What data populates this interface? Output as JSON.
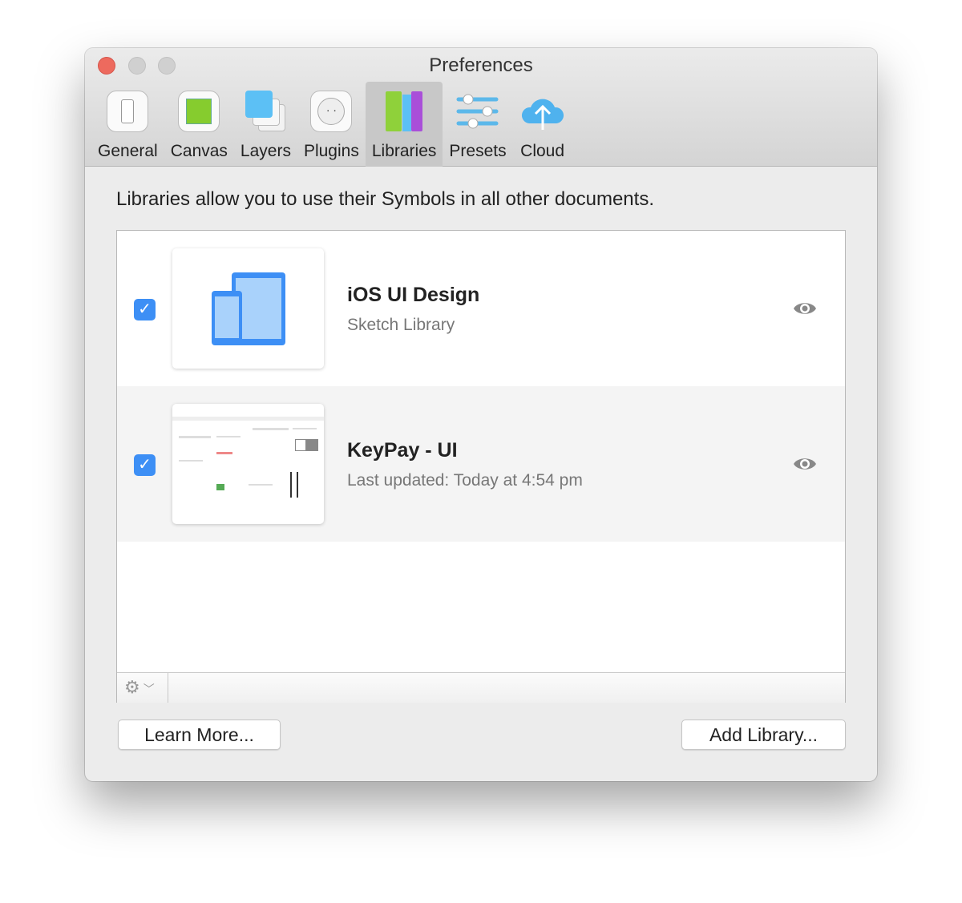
{
  "window": {
    "title": "Preferences"
  },
  "tabs": [
    {
      "label": "General",
      "icon": "general-switch-icon"
    },
    {
      "label": "Canvas",
      "icon": "canvas-icon"
    },
    {
      "label": "Layers",
      "icon": "layers-icon"
    },
    {
      "label": "Plugins",
      "icon": "plugins-icon"
    },
    {
      "label": "Libraries",
      "icon": "libraries-icon",
      "active": true
    },
    {
      "label": "Presets",
      "icon": "presets-icon"
    },
    {
      "label": "Cloud",
      "icon": "cloud-icon"
    }
  ],
  "description": "Libraries allow you to use their Symbols in all other documents.",
  "libraries": [
    {
      "name": "iOS UI Design",
      "subtitle": "Sketch Library",
      "enabled": true
    },
    {
      "name": "KeyPay - UI",
      "subtitle": "Last updated: Today at 4:54 pm",
      "enabled": true
    }
  ],
  "buttons": {
    "learn_more": "Learn More...",
    "add_library": "Add Library..."
  },
  "colors": {
    "accent": "#3d8ff5",
    "close": "#ed6a5e"
  }
}
